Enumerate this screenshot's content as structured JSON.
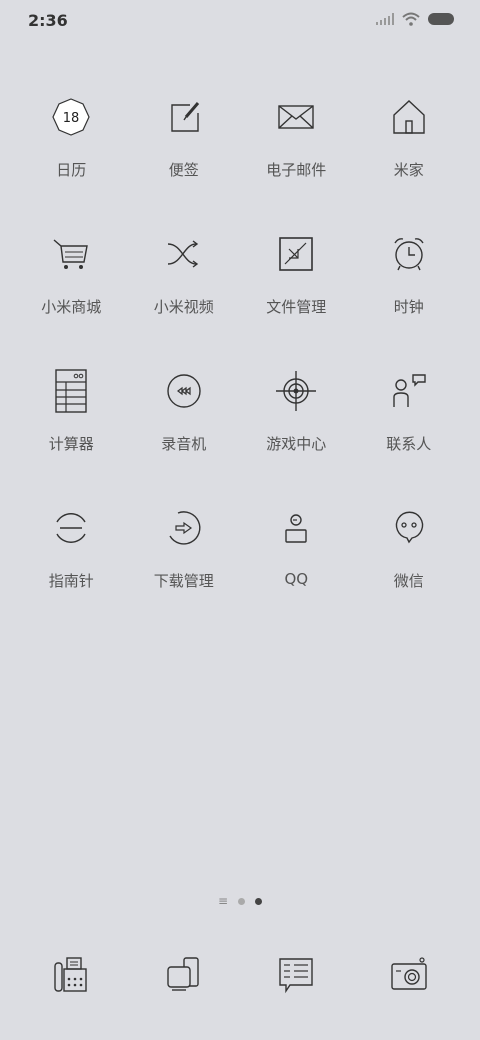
{
  "status_bar": {
    "time": "2:36"
  },
  "apps": [
    {
      "label": "日历",
      "icon": "calendar-icon",
      "badge_text": "18"
    },
    {
      "label": "便签",
      "icon": "notes-icon"
    },
    {
      "label": "电子邮件",
      "icon": "mail-icon"
    },
    {
      "label": "米家",
      "icon": "home-icon"
    },
    {
      "label": "小米商城",
      "icon": "cart-icon"
    },
    {
      "label": "小米视频",
      "icon": "shuffle-icon"
    },
    {
      "label": "文件管理",
      "icon": "file-manager-icon"
    },
    {
      "label": "时钟",
      "icon": "alarm-clock-icon"
    },
    {
      "label": "计算器",
      "icon": "calculator-icon"
    },
    {
      "label": "录音机",
      "icon": "rewind-icon"
    },
    {
      "label": "游戏中心",
      "icon": "crosshair-icon"
    },
    {
      "label": "联系人",
      "icon": "contact-icon"
    },
    {
      "label": "指南针",
      "icon": "compass-icon"
    },
    {
      "label": "下载管理",
      "icon": "download-icon"
    },
    {
      "label": "QQ",
      "icon": "qq-icon"
    },
    {
      "label": "微信",
      "icon": "wechat-icon"
    }
  ],
  "page_indicator": {
    "pages": 3,
    "active": 3
  },
  "dock": [
    {
      "icon": "fax-phone-icon"
    },
    {
      "icon": "devices-icon"
    },
    {
      "icon": "messages-icon"
    },
    {
      "icon": "camera-icon"
    }
  ]
}
